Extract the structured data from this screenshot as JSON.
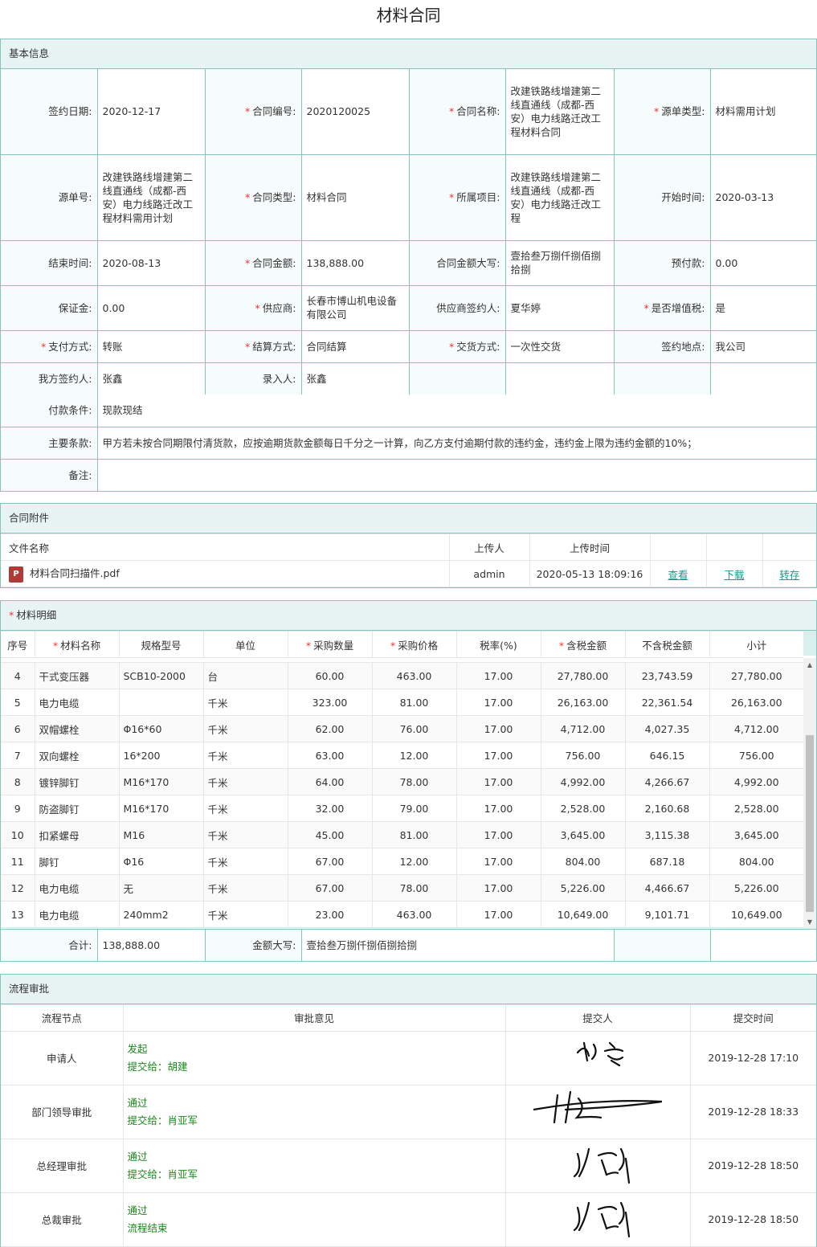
{
  "title": "材料合同",
  "basic": {
    "section_title": "基本信息",
    "rows": [
      [
        {
          "label": "签约日期:",
          "value": "2020-12-17",
          "req": false
        },
        {
          "label": "合同编号:",
          "value": "2020120025",
          "req": true
        },
        {
          "label": "合同名称:",
          "value": "改建铁路线增建第二线直通线（成都-西安）电力线路迁改工程材料合同",
          "req": true
        },
        {
          "label": "源单类型:",
          "value": "材料需用计划",
          "req": true
        }
      ],
      [
        {
          "label": "源单号:",
          "value": "改建铁路线增建第二线直通线（成都-西安）电力线路迁改工程材料需用计划",
          "req": false
        },
        {
          "label": "合同类型:",
          "value": "材料合同",
          "req": true
        },
        {
          "label": "所属项目:",
          "value": "改建铁路线增建第二线直通线（成都-西安）电力线路迁改工程",
          "req": true
        },
        {
          "label": "开始时间:",
          "value": "2020-03-13",
          "req": false
        }
      ],
      [
        {
          "label": "结束时间:",
          "value": "2020-08-13",
          "req": false
        },
        {
          "label": "合同金额:",
          "value": "138,888.00",
          "req": true
        },
        {
          "label": "合同金额大写:",
          "value": "壹拾叁万捌仟捌佰捌拾捌",
          "req": false
        },
        {
          "label": "预付款:",
          "value": "0.00",
          "req": false
        }
      ],
      [
        {
          "label": "保证金:",
          "value": "0.00",
          "req": false
        },
        {
          "label": "供应商:",
          "value": "长春市博山机电设备有限公司",
          "req": true
        },
        {
          "label": "供应商签约人:",
          "value": "夏华婷",
          "req": false
        },
        {
          "label": "是否增值税:",
          "value": "是",
          "req": true
        }
      ],
      [
        {
          "label": "支付方式:",
          "value": "转账",
          "req": true
        },
        {
          "label": "结算方式:",
          "value": "合同结算",
          "req": true
        },
        {
          "label": "交货方式:",
          "value": "一次性交货",
          "req": true
        },
        {
          "label": "签约地点:",
          "value": "我公司",
          "req": false
        }
      ],
      [
        {
          "label": "我方签约人:",
          "value": "张鑫",
          "req": false
        },
        {
          "label": "录入人:",
          "value": "张鑫",
          "req": false
        },
        {
          "label": "",
          "value": "",
          "req": false
        },
        {
          "label": "",
          "value": "",
          "req": false
        }
      ]
    ],
    "payment_terms_label": "付款条件:",
    "payment_terms": "现款现结",
    "main_terms_label": "主要条款:",
    "main_terms": "甲方若未按合同期限付清货款，应按逾期货款金额每日千分之一计算，向乙方支付逾期付款的违约金，违约金上限为违约金额的10%；",
    "remarks_label": "备注:",
    "remarks": ""
  },
  "attachments": {
    "section_title": "合同附件",
    "headers": [
      "文件名称",
      "上传人",
      "上传时间"
    ],
    "files": [
      {
        "name": "材料合同扫描件.pdf",
        "icon": "pdf-file-icon",
        "uploader": "admin",
        "time": "2020-05-13 18:09:16",
        "view": "查看",
        "download": "下载",
        "save": "转存"
      }
    ]
  },
  "materials": {
    "section_title": "材料明细",
    "headers": [
      {
        "t": "序号",
        "r": false
      },
      {
        "t": "材料名称",
        "r": true
      },
      {
        "t": "规格型号",
        "r": false
      },
      {
        "t": "单位",
        "r": false
      },
      {
        "t": "采购数量",
        "r": true
      },
      {
        "t": "采购价格",
        "r": true
      },
      {
        "t": "税率(%)",
        "r": false
      },
      {
        "t": "含税金额",
        "r": true
      },
      {
        "t": "不含税金额",
        "r": false
      },
      {
        "t": "小计",
        "r": false
      }
    ],
    "rows": [
      [
        "4",
        "干式变压器",
        "SCB10-2000",
        "台",
        "60.00",
        "463.00",
        "17.00",
        "27,780.00",
        "23,743.59",
        "27,780.00"
      ],
      [
        "5",
        "电力电缆",
        "",
        "千米",
        "323.00",
        "81.00",
        "17.00",
        "26,163.00",
        "22,361.54",
        "26,163.00"
      ],
      [
        "6",
        "双帽螺栓",
        "Φ16*60",
        "千米",
        "62.00",
        "76.00",
        "17.00",
        "4,712.00",
        "4,027.35",
        "4,712.00"
      ],
      [
        "7",
        "双向螺栓",
        "16*200",
        "千米",
        "63.00",
        "12.00",
        "17.00",
        "756.00",
        "646.15",
        "756.00"
      ],
      [
        "8",
        "镀锌脚钉",
        "M16*170",
        "千米",
        "64.00",
        "78.00",
        "17.00",
        "4,992.00",
        "4,266.67",
        "4,992.00"
      ],
      [
        "9",
        "防盗脚钉",
        "M16*170",
        "千米",
        "32.00",
        "79.00",
        "17.00",
        "2,528.00",
        "2,160.68",
        "2,528.00"
      ],
      [
        "10",
        "扣紧螺母",
        "M16",
        "千米",
        "45.00",
        "81.00",
        "17.00",
        "3,645.00",
        "3,115.38",
        "3,645.00"
      ],
      [
        "11",
        "脚钉",
        "Φ16",
        "千米",
        "67.00",
        "12.00",
        "17.00",
        "804.00",
        "687.18",
        "804.00"
      ],
      [
        "12",
        "电力电缆",
        "无",
        "千米",
        "67.00",
        "78.00",
        "17.00",
        "5,226.00",
        "4,466.67",
        "5,226.00"
      ],
      [
        "13",
        "电力电缆",
        "240mm2",
        "千米",
        "23.00",
        "463.00",
        "17.00",
        "10,649.00",
        "9,101.71",
        "10,649.00"
      ]
    ],
    "total_label": "合计:",
    "total": "138,888.00",
    "total_words_label": "金额大写:",
    "total_words": "壹拾叁万捌仟捌佰捌拾捌"
  },
  "process": {
    "section_title": "流程审批",
    "headers": [
      "流程节点",
      "审批意见",
      "提交人",
      "提交时间"
    ],
    "rows": [
      {
        "node": "申请人",
        "opinion": "发起",
        "next": "提交给：胡建",
        "signer": "张鑫",
        "time": "2019-12-28 17:10"
      },
      {
        "node": "部门领导审批",
        "opinion": "通过",
        "next": "提交给：肖亚军",
        "signer": "胡建",
        "time": "2019-12-28 18:33"
      },
      {
        "node": "总经理审批",
        "opinion": "通过",
        "next": "提交给：肖亚军",
        "signer": "肖亚军",
        "time": "2019-12-28 18:50"
      },
      {
        "node": "总裁审批",
        "opinion": "通过",
        "next": "流程结束",
        "signer": "肖亚军",
        "time": "2019-12-28 18:50"
      }
    ]
  },
  "colors": {
    "border": "#86c3bc",
    "header_bg": "#e7f4f3",
    "required": "#e33333",
    "link": "#12a08c",
    "opinion": "#1a8a1a"
  }
}
